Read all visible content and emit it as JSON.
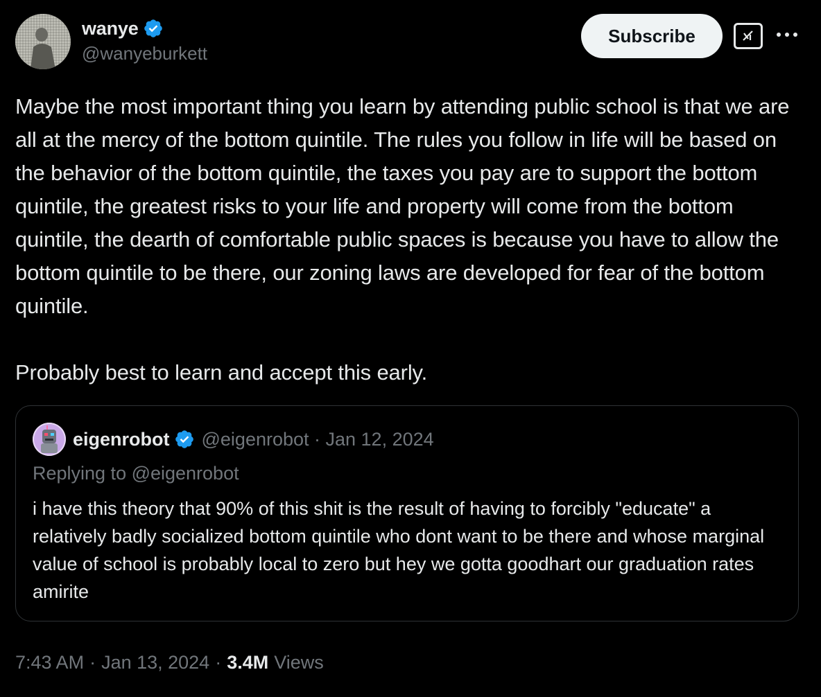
{
  "author": {
    "display_name": "wanye",
    "handle": "@wanyeburkett",
    "verified": true
  },
  "actions": {
    "subscribe_label": "Subscribe",
    "grok_icon": "grok-icon",
    "more_icon": "more-icon"
  },
  "tweet": {
    "paragraphs": [
      "Maybe the most important thing you learn by attending public school is that we are all at the mercy of the bottom quintile. The rules you follow in life will be based on the behavior of the bottom quintile, the taxes you pay are to support the bottom quintile, the greatest risks to your life and property will come from the bottom quintile, the dearth of comfortable public spaces is because you have to allow the bottom quintile to be there, our zoning laws are developed for fear of the bottom quintile.",
      "Probably best to learn and accept this early."
    ]
  },
  "quote": {
    "display_name": "eigenrobot",
    "handle": "@eigenrobot",
    "date": "Jan 12, 2024",
    "meta": "@eigenrobot · Jan 12, 2024",
    "replying_to": "Replying to @eigenrobot",
    "text": "i have this theory that 90% of this shit is the result of having to forcibly \"educate\" a relatively badly socialized bottom quintile who dont want to be there and whose marginal value of school is probably local to zero but hey we gotta goodhart our graduation rates amirite"
  },
  "footer": {
    "time": "7:43 AM",
    "date": "Jan 13, 2024",
    "separator": "·",
    "views_count": "3.4M",
    "views_label": "Views"
  },
  "colors": {
    "background": "#000000",
    "text_primary": "#e7e9ea",
    "text_secondary": "#71767b",
    "verified_blue": "#1d9bf0",
    "border": "#2f3336",
    "button_bg": "#eff3f4"
  }
}
